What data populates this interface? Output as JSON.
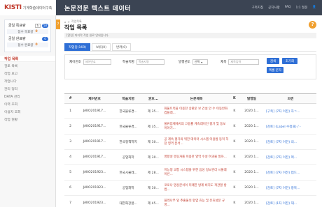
{
  "logo": {
    "brand": "KISTI",
    "subtitle": "기계학습데이터구축"
  },
  "header": {
    "title": "논문전문 텍스트 데이터",
    "links": [
      "구축지침",
      "공지사항",
      "FAQ",
      "1:1 질문",
      "👤"
    ]
  },
  "sidebar": {
    "stats": [
      {
        "label": "금일 목표량",
        "button": "↻",
        "count": "50",
        "sub_label": "접수 목표량",
        "sub_value": "0"
      },
      {
        "label": "금일 완료량",
        "count": "0",
        "sub_label": "접수 완료량",
        "sub_value": "0"
      }
    ],
    "menu_title": "작업 목록",
    "menu_items": [
      "검토 목록",
      "작업 보고",
      "작업니다",
      "관리 정리",
      "DATA 관리",
      "이력 조회",
      "이용자 조회",
      "작업 현황"
    ],
    "tab_icon": "?"
  },
  "main": {
    "breadcrumb": [
      "⌂",
      ">",
      "작업목록"
    ],
    "title": "작업 목록",
    "help": "?",
    "notice": "[알림] 마지막 작업 완료 안내입니다.",
    "tabs": [
      {
        "label": "작업중(169)",
        "active": true
      },
      {
        "label": "보류(0)",
        "active": false
      },
      {
        "label": "반려(0)",
        "active": false
      }
    ],
    "filters": {
      "id_label": "제어번호",
      "id_placeholder": "제어번호",
      "field_label": "학술지명",
      "field_placeholder": "학술지명",
      "difficulty_label": "발행년도",
      "difficulty_value": "선택",
      "title_label": "제목",
      "title_placeholder": "제목입력",
      "search_button": "검색",
      "reset_button": "초기화",
      "extra_button": "엑셀 문자"
    },
    "table": {
      "headers": [
        "#",
        "제어번호",
        "학술지명",
        "권호...",
        "논문제목",
        "K",
        "발행일",
        "의견"
      ],
      "rows": [
        {
          "num": "1",
          "id": "JAKO201917...",
          "journal": "한국물류경...",
          "vol": "제 35...",
          "title": "화물트럭을 이용한 상판운 보 건설 안 수 이동반화 컴플레...",
          "k": "K",
          "date": "2020.1...",
          "opinion": "[구축] (7자 이전) 하ㄱ...",
          "status": ""
        },
        {
          "num": "2",
          "id": "JAKO201917...",
          "journal": "한국물류경...",
          "vol": "제 35...",
          "title": "물류업체에서의 고용률 계속레이전 평가 및 동보 이야기...",
          "k": "K",
          "date": "2020.1...",
          "opinion": "[검토] (Label 수정표) / -",
          "status": ""
        },
        {
          "num": "3",
          "id": "JAKO201917...",
          "journal": "한국정책학지",
          "vol": "제 30...",
          "title": "공 계속 평가의 위한 데이터 시스템 이용법 동적 하천 영역 분석...",
          "k": "K",
          "date": "2020.1...",
          "opinion": "[검토] (7자 이전) 의...",
          "status": ""
        },
        {
          "num": "4",
          "id": "JAKO201917...",
          "journal": "공업화학",
          "vol": "제 30...",
          "title": "영향성 유동자를 이용한 영역 수성 여과물 절차...",
          "k": "K",
          "date": "2020.1...",
          "opinion": "[검토] (7자 이전) 여...",
          "status": ""
        },
        {
          "num": "5",
          "id": "JAKO201923...",
          "journal": "한국시뮬레...",
          "vol": "제 28...",
          "title": "지능형 교통 시스템을 위한 음성 정보관리 시뮬레이션...",
          "k": "K",
          "date": "2020.1...",
          "opinion": "[검토] (7자 이전) 업드...",
          "status": ""
        },
        {
          "num": "6",
          "id": "JAKO201923...",
          "journal": "공업화학",
          "vol": "제 30...",
          "title": "코로나 영상분석이 미래한 방계 비지도 객관할 방법...",
          "k": "K",
          "date": "2020.1...",
          "opinion": "[검토] (7자 이전) 항목...",
          "status": ""
        },
        {
          "num": "7",
          "id": "JAKO201923...",
          "journal": "대한화장품...",
          "vol": "제 45...",
          "title": "플레나무 잎 추출물의 항염 효능 및 유효성분 규명...",
          "k": "K",
          "date": "2020.1...",
          "opinion": "[검토] (1자 이전) 재...",
          "status": ""
        }
      ]
    }
  }
}
